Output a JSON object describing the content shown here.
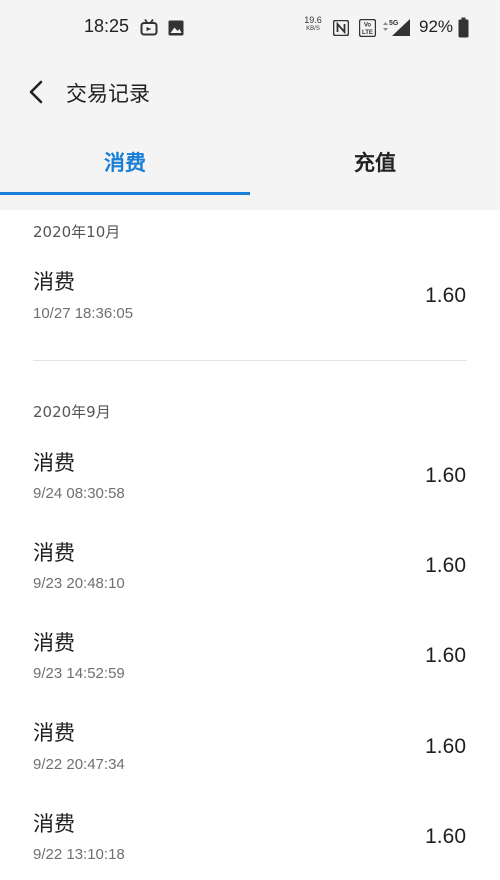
{
  "status_bar": {
    "time": "18:25",
    "net_speed_value": "19.6",
    "net_speed_unit": "KB/S",
    "volte_label": "VoLTE",
    "network": "5G",
    "battery_percent": "92%",
    "icons": [
      "notification-app-icon",
      "image-icon",
      "nfc-icon",
      "volte-icon",
      "signal-icon",
      "battery-icon"
    ]
  },
  "header": {
    "title": "交易记录",
    "back_icon": "chevron-left-icon"
  },
  "tabs": [
    {
      "label": "消费",
      "active": true
    },
    {
      "label": "充值",
      "active": false
    }
  ],
  "colors": {
    "accent": "#1a7fd6",
    "header_bg": "#f4f4f4"
  },
  "sections": [
    {
      "month": "2020年10月",
      "records": [
        {
          "title": "消费",
          "time": "10/27 18:36:05",
          "amount": "1.60"
        }
      ]
    },
    {
      "month": "2020年9月",
      "records": [
        {
          "title": "消费",
          "time": "9/24 08:30:58",
          "amount": "1.60"
        },
        {
          "title": "消费",
          "time": "9/23 20:48:10",
          "amount": "1.60"
        },
        {
          "title": "消费",
          "time": "9/23 14:52:59",
          "amount": "1.60"
        },
        {
          "title": "消费",
          "time": "9/22 20:47:34",
          "amount": "1.60"
        },
        {
          "title": "消费",
          "time": "9/22 13:10:18",
          "amount": "1.60"
        }
      ]
    }
  ]
}
